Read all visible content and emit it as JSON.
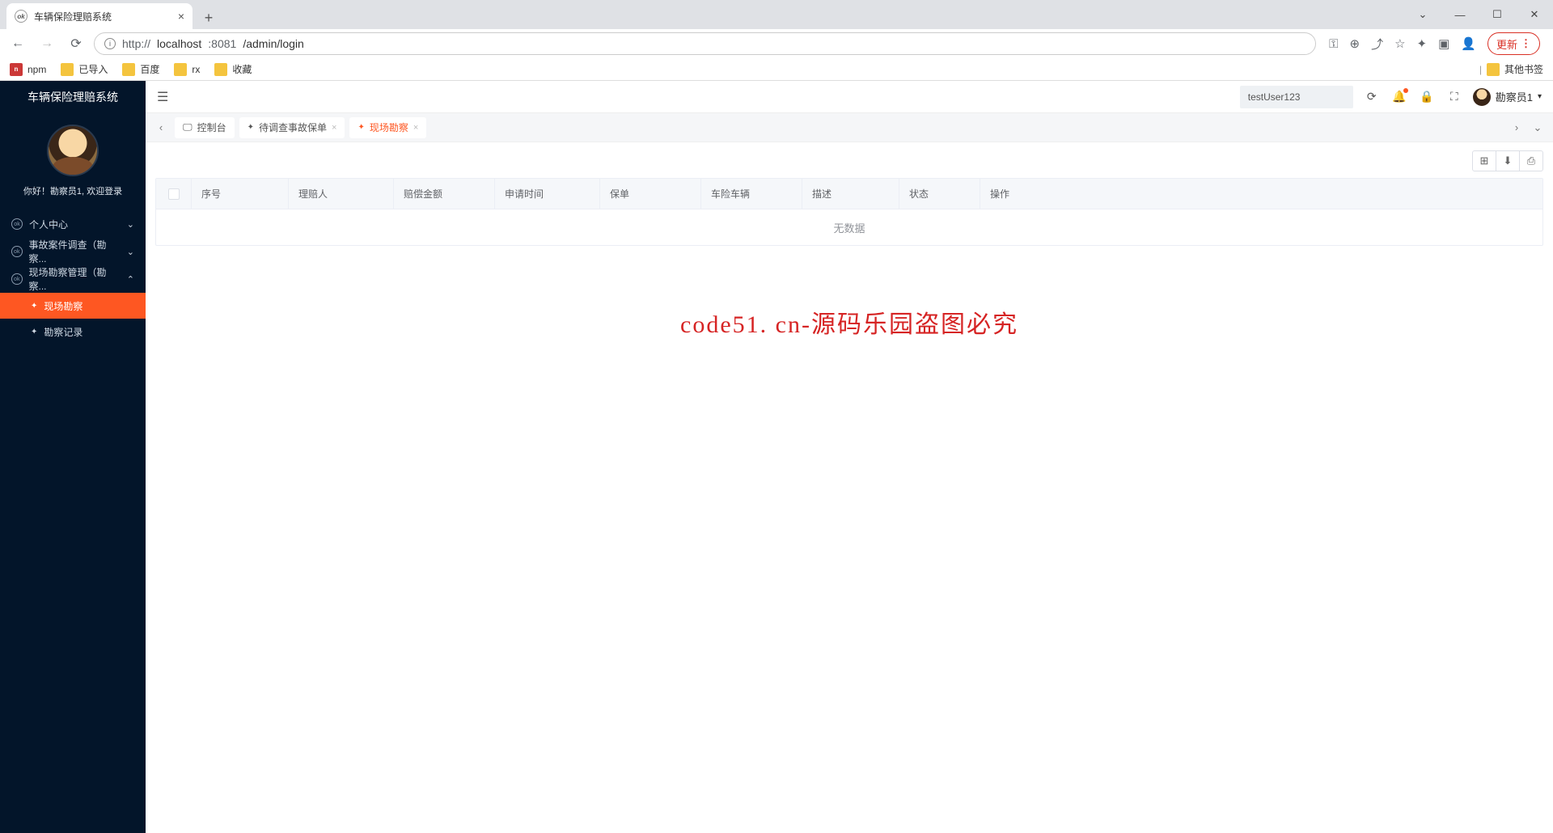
{
  "browser": {
    "tab_title": "车辆保险理赔系统",
    "url_host": "localhost",
    "url_port": ":8081",
    "url_path": "/admin/login",
    "update_button": "更新",
    "other_bookmarks": "其他书签",
    "bookmarks": {
      "npm": "npm",
      "imported": "已导入",
      "baidu": "百度",
      "rx": "rx",
      "fav": "收藏"
    }
  },
  "sidebar": {
    "title": "车辆保险理赔系统",
    "welcome": "你好！勘察员1, 欢迎登录",
    "menu": {
      "personal": "个人中心",
      "investigation": "事故案件调查（勘察...",
      "survey_mgmt": "现场勘察管理（勘察..."
    },
    "submenu": {
      "survey": "现场勘察",
      "record": "勘察记录"
    }
  },
  "header": {
    "search_value": "testUser123",
    "username": "勘察员1"
  },
  "tabs": {
    "console": "控制台",
    "pending": "待调查事故保单",
    "survey": "现场勘察"
  },
  "table": {
    "columns": {
      "seq": "序号",
      "person": "理赔人",
      "amount": "赔偿金额",
      "time": "申请时间",
      "policy": "保单",
      "vehicle": "车险车辆",
      "desc": "描述",
      "status": "状态",
      "op": "操作"
    },
    "empty": "无数据"
  },
  "watermark": "code51. cn-源码乐园盗图必究"
}
